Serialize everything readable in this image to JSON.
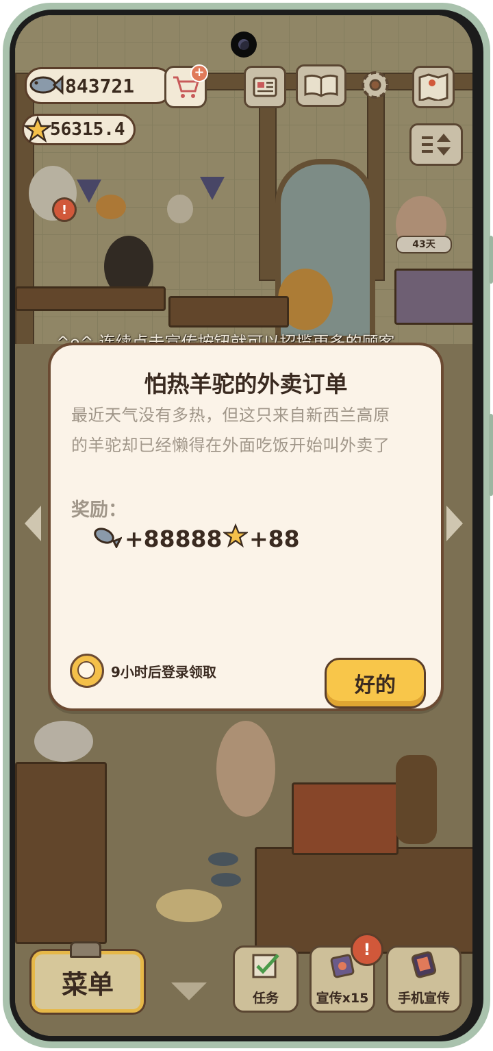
{
  "hud": {
    "fish_count": "843721",
    "star_count": "56315.4",
    "days_badge": "43天"
  },
  "tip_text": "^o^ 连续点击宣传按钮就可以招揽更多的顾客",
  "dialog": {
    "title": "怕热羊驼的外卖订单",
    "description_line1": "最近天气没有多热，但这只来自新西兰高原",
    "description_line2": "的羊驼却已经懒得在外面吃饭开始叫外卖了",
    "reward_label": "奖励：",
    "reward_fish": "+88888",
    "reward_star": "+88",
    "timer_text": "9小时后登录领取",
    "ok_label": "好的"
  },
  "bottom_bar": {
    "menu_label": "菜单",
    "tasks_label": "任务",
    "promo_label": "宣传x15",
    "phone_promo_label": "手机宣传"
  },
  "colors": {
    "dialog_bg": "#fbf3e8",
    "ok_button": "#f8c64a",
    "alert_red": "#d1583a",
    "phone_frame": "#a9c2ad"
  },
  "icons": [
    "fish-icon",
    "star-icon",
    "shop-cart-icon",
    "newspaper-icon",
    "book-icon",
    "gear-icon",
    "map-icon",
    "sort-icon",
    "clock-icon",
    "checklist-icon",
    "phone-promo-icon",
    "alert-icon"
  ]
}
